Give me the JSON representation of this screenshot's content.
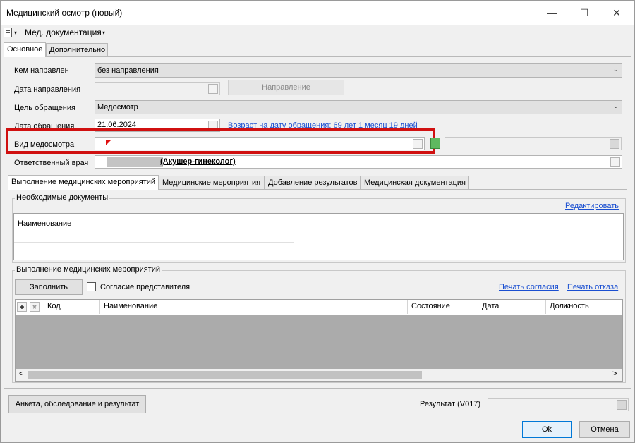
{
  "window": {
    "title": "Медицинский осмотр (новый)",
    "minimize": "—",
    "maximize": "☐",
    "close": "✕"
  },
  "menubar": {
    "menu_label": "Мед. документация",
    "arrow": "▾"
  },
  "top_tabs": [
    "Основное",
    "Дополнительно"
  ],
  "form": {
    "referred_by_label": "Кем направлен",
    "referred_by_value": "без направления",
    "referral_date_label": "Дата направления",
    "referral_button": "Направление",
    "purpose_label": "Цель обращения",
    "purpose_value": "Медосмотр",
    "visit_date_label": "Дата обращения",
    "visit_date_value": "21.06.2024",
    "age_text": "Возраст на дату обращения:  69 лет 1 месяц 19 дней",
    "exam_type_label": "Вид медосмотра",
    "exam_type_value": "",
    "doctor_label": "Ответственный врач",
    "doctor_specialty": "(Акушер-гинеколог)",
    "chevron": "⌄",
    "ellipsis": "..."
  },
  "mid_tabs": [
    "Выполнение медицинских мероприятий",
    "Медицинские мероприятия",
    "Добавление результатов",
    "Медицинская документация"
  ],
  "documents": {
    "group_title": "Необходимые документы",
    "edit_link": "Редактировать",
    "col_name": "Наименование"
  },
  "activities": {
    "group_title": "Выполнение медицинских мероприятий",
    "fill_button": "Заполнить",
    "consent_label": "Согласие представителя",
    "consent_checked": false,
    "print_consent_link": "Печать согласия",
    "print_refusal_link": "Печать отказа",
    "add_icon": "✚",
    "remove_icon": "✖",
    "columns": [
      "Код",
      "Наименование",
      "Состояние",
      "Дата",
      "Должность"
    ],
    "scroll_left": "<",
    "scroll_right": ">"
  },
  "bottom": {
    "survey_button": "Анкета, обследование и результат",
    "result_label": "Результат (V017)",
    "result_value": "",
    "ok_button": "Ok",
    "cancel_button": "Отмена"
  },
  "colors": {
    "highlight_border": "#d01010",
    "link": "#1a4fd1"
  }
}
